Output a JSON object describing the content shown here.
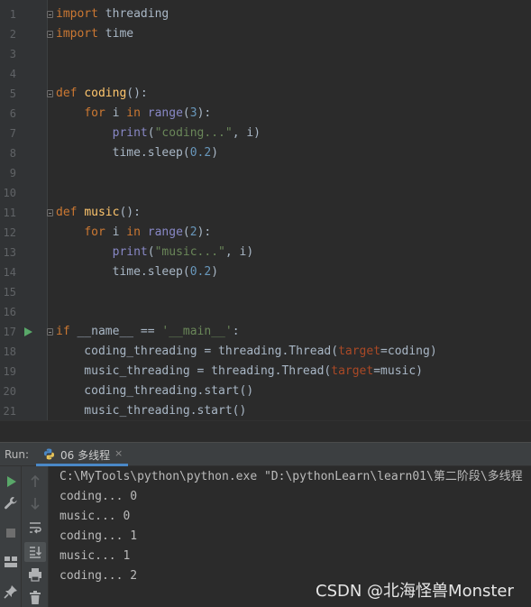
{
  "editor": {
    "lines": [
      {
        "n": "1",
        "tokens": [
          {
            "t": "import",
            "c": "kw"
          },
          {
            "t": " threading",
            "c": ""
          }
        ],
        "fold": true
      },
      {
        "n": "2",
        "tokens": [
          {
            "t": "import",
            "c": "kw"
          },
          {
            "t": " time",
            "c": ""
          }
        ],
        "fold": true
      },
      {
        "n": "3",
        "tokens": []
      },
      {
        "n": "4",
        "tokens": []
      },
      {
        "n": "5",
        "tokens": [
          {
            "t": "def",
            "c": "kw"
          },
          {
            "t": " ",
            "c": ""
          },
          {
            "t": "coding",
            "c": "fn"
          },
          {
            "t": "():",
            "c": ""
          }
        ],
        "fold": true
      },
      {
        "n": "6",
        "tokens": [
          {
            "t": "    ",
            "c": ""
          },
          {
            "t": "for",
            "c": "kw"
          },
          {
            "t": " i ",
            "c": ""
          },
          {
            "t": "in",
            "c": "kw"
          },
          {
            "t": " ",
            "c": ""
          },
          {
            "t": "range",
            "c": "bi"
          },
          {
            "t": "(",
            "c": ""
          },
          {
            "t": "3",
            "c": "num"
          },
          {
            "t": "):",
            "c": ""
          }
        ]
      },
      {
        "n": "7",
        "tokens": [
          {
            "t": "        ",
            "c": ""
          },
          {
            "t": "print",
            "c": "bi"
          },
          {
            "t": "(",
            "c": ""
          },
          {
            "t": "\"coding...\"",
            "c": "str"
          },
          {
            "t": ", i)",
            "c": ""
          }
        ]
      },
      {
        "n": "8",
        "tokens": [
          {
            "t": "        time.sleep(",
            "c": ""
          },
          {
            "t": "0.2",
            "c": "num"
          },
          {
            "t": ")",
            "c": ""
          }
        ]
      },
      {
        "n": "9",
        "tokens": []
      },
      {
        "n": "10",
        "tokens": []
      },
      {
        "n": "11",
        "tokens": [
          {
            "t": "def",
            "c": "kw"
          },
          {
            "t": " ",
            "c": ""
          },
          {
            "t": "music",
            "c": "fn"
          },
          {
            "t": "():",
            "c": ""
          }
        ],
        "fold": true
      },
      {
        "n": "12",
        "tokens": [
          {
            "t": "    ",
            "c": ""
          },
          {
            "t": "for",
            "c": "kw"
          },
          {
            "t": " i ",
            "c": ""
          },
          {
            "t": "in",
            "c": "kw"
          },
          {
            "t": " ",
            "c": ""
          },
          {
            "t": "range",
            "c": "bi"
          },
          {
            "t": "(",
            "c": ""
          },
          {
            "t": "2",
            "c": "num"
          },
          {
            "t": "):",
            "c": ""
          }
        ]
      },
      {
        "n": "13",
        "tokens": [
          {
            "t": "        ",
            "c": ""
          },
          {
            "t": "print",
            "c": "bi"
          },
          {
            "t": "(",
            "c": ""
          },
          {
            "t": "\"music...\"",
            "c": "str"
          },
          {
            "t": ", i)",
            "c": ""
          }
        ]
      },
      {
        "n": "14",
        "tokens": [
          {
            "t": "        time.sleep(",
            "c": ""
          },
          {
            "t": "0.2",
            "c": "num"
          },
          {
            "t": ")",
            "c": ""
          }
        ]
      },
      {
        "n": "15",
        "tokens": []
      },
      {
        "n": "16",
        "tokens": []
      },
      {
        "n": "17",
        "tokens": [
          {
            "t": "if",
            "c": "kw"
          },
          {
            "t": " __name__ == ",
            "c": ""
          },
          {
            "t": "'__main__'",
            "c": "str"
          },
          {
            "t": ":",
            "c": ""
          }
        ],
        "fold": true,
        "run": true
      },
      {
        "n": "18",
        "tokens": [
          {
            "t": "    coding_threading = threading.Thread(",
            "c": ""
          },
          {
            "t": "target",
            "c": "par"
          },
          {
            "t": "=coding)",
            "c": ""
          }
        ]
      },
      {
        "n": "19",
        "tokens": [
          {
            "t": "    music_threading = threading.Thread(",
            "c": ""
          },
          {
            "t": "target",
            "c": "par"
          },
          {
            "t": "=music)",
            "c": ""
          }
        ]
      },
      {
        "n": "20",
        "tokens": [
          {
            "t": "    coding_threading.start()",
            "c": ""
          }
        ]
      },
      {
        "n": "21",
        "tokens": [
          {
            "t": "    music_threading.start()",
            "c": ""
          }
        ]
      }
    ]
  },
  "run_panel": {
    "label": "Run:",
    "tab_title": "06 多线程",
    "tab_close": "×"
  },
  "console": {
    "lines": [
      "C:\\MyTools\\python\\python.exe \"D:\\pythonLearn\\learn01\\第二阶段\\多线程",
      "coding... 0",
      "music... 0",
      "coding... 1",
      "music... 1",
      "coding... 2"
    ]
  },
  "watermark": "CSDN @北海怪兽Monster",
  "colors": {
    "keyword": "#cc7832",
    "function": "#ffc66d",
    "builtin": "#8888c6",
    "number": "#6897bb",
    "string": "#6a8759",
    "param": "#aa4926",
    "text": "#a9b7c6",
    "run_green": "#59a869"
  }
}
